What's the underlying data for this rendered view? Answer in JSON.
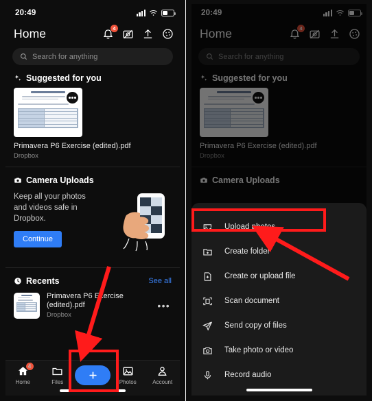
{
  "status": {
    "time": "20:49",
    "signal_icon": "cellular-signal-icon",
    "wifi_icon": "wifi-icon",
    "battery_icon": "battery-icon"
  },
  "header": {
    "title": "Home",
    "icons": [
      {
        "name": "notifications-bell-icon",
        "badge": "4"
      },
      {
        "name": "camera-uploads-off-icon",
        "badge": ""
      },
      {
        "name": "upload-icon",
        "badge": ""
      },
      {
        "name": "theme-palette-icon",
        "badge": ""
      }
    ]
  },
  "search": {
    "placeholder": "Search for anything",
    "icon": "search-icon"
  },
  "suggested": {
    "section_title": "Suggested for you",
    "section_icon": "sparkle-icon",
    "card": {
      "title": "Primavera P6 Exercise (edited).pdf",
      "subtitle": "Dropbox",
      "overflow_icon": "more-horizontal-icon",
      "doc_heading": "P6 Competency Test Instructions"
    }
  },
  "camera_uploads": {
    "section_title": "Camera Uploads",
    "section_icon": "camera-icon",
    "promo_text": "Keep all your photos and videos safe in Dropbox.",
    "cta_label": "Continue",
    "illustration": "hand-holding-phone-illustration"
  },
  "recents": {
    "section_title": "Recents",
    "section_icon": "clock-icon",
    "see_all_label": "See all",
    "items": [
      {
        "title": "Primavera P6 Exercise (edited).pdf",
        "subtitle": "Dropbox",
        "overflow_icon": "more-horizontal-icon"
      }
    ]
  },
  "tabbar": {
    "items": [
      {
        "label": "Home",
        "icon": "home-icon",
        "badge": "4"
      },
      {
        "label": "Files",
        "icon": "folder-icon",
        "badge": ""
      },
      {
        "label": "",
        "icon": "plus-icon",
        "badge": ""
      },
      {
        "label": "Photos",
        "icon": "photos-icon",
        "badge": ""
      },
      {
        "label": "Account",
        "icon": "account-person-icon",
        "badge": ""
      }
    ],
    "create_button_label": "+"
  },
  "sheet": {
    "grabber": "sheet-drag-handle",
    "items": [
      {
        "label": "Upload photos",
        "icon": "upload-photos-icon"
      },
      {
        "label": "Create folder",
        "icon": "create-folder-icon"
      },
      {
        "label": "Create or upload file",
        "icon": "create-file-icon"
      },
      {
        "label": "Scan document",
        "icon": "scan-document-icon"
      },
      {
        "label": "Send copy of files",
        "icon": "send-copy-icon"
      },
      {
        "label": "Take photo or video",
        "icon": "take-photo-icon"
      },
      {
        "label": "Record audio",
        "icon": "record-audio-icon"
      }
    ]
  },
  "annotations": {
    "accent_color": "#ff1b1b",
    "left_highlight_target": "create-button",
    "right_highlight_target": "sheet-item-upload-photos",
    "left_arrow": "down-arrow-to-create-button",
    "right_arrow": "up-left-arrow-to-upload-photos"
  },
  "colors": {
    "background": "#0d0d0d",
    "sheet": "#1b1b1b",
    "accent_blue": "#2f7df6",
    "link_blue": "#3b82f6",
    "badge_red": "#f0543c"
  }
}
